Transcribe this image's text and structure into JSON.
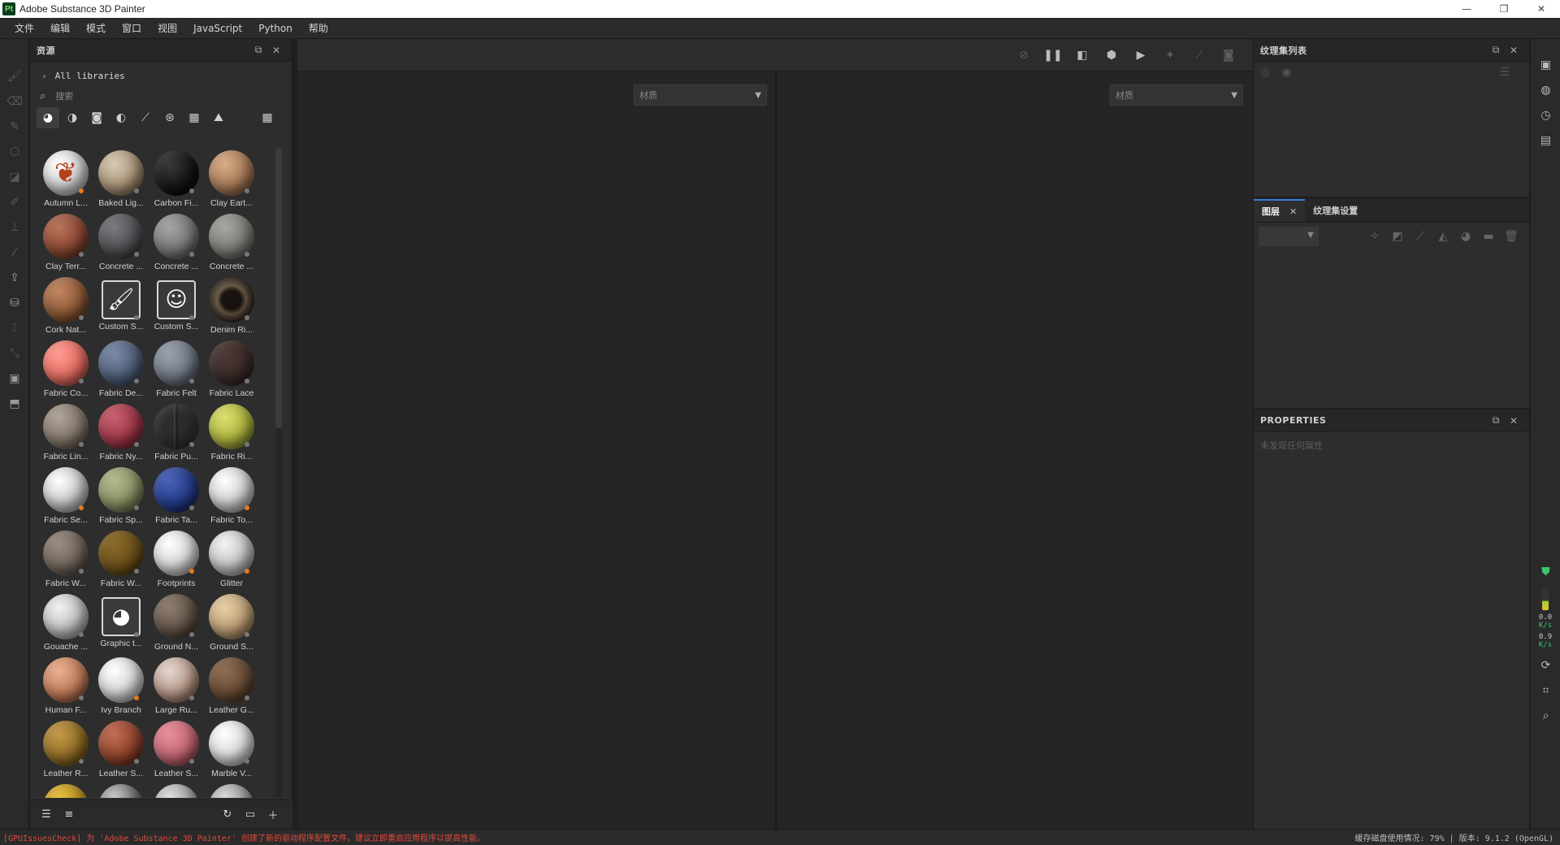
{
  "window": {
    "app_icon": "Pt",
    "title": "Adobe Substance 3D Painter",
    "minimize": "—",
    "restore": "❐",
    "close": "✕"
  },
  "menu": [
    "文件",
    "编辑",
    "模式",
    "窗口",
    "视图",
    "JavaScript",
    "Python",
    "帮助"
  ],
  "assets": {
    "title": "资源",
    "libraries": "All libraries",
    "search_placeholder": "搜索",
    "items": [
      {
        "name": "Autumn L...",
        "color": "radial-gradient(circle at 35% 30%, #ffffff, #d8d8d8 40%, #8a8a8a)",
        "badge": "orange",
        "leaf": true
      },
      {
        "name": "Baked Lig...",
        "color": "radial-gradient(circle at 35% 30%, #d9cbb4, #a48f74 55%, #5a4a38)",
        "badge": "grey"
      },
      {
        "name": "Carbon Fi...",
        "color": "radial-gradient(circle at 35% 30%, #3a3a3a, #111 60%, #000)",
        "badge": "grey"
      },
      {
        "name": "Clay Eart...",
        "color": "radial-gradient(circle at 35% 30%, #d7ad88, #a67756 55%, #5e3d28)",
        "badge": "grey"
      },
      {
        "name": "Clay Terr...",
        "color": "radial-gradient(circle at 35% 30%, #b8735a, #8a4632 55%, #4a2418)",
        "badge": "grey"
      },
      {
        "name": "Concrete ...",
        "color": "radial-gradient(circle at 35% 30%, #7a7a7e, #4e4e52 55%, #2a2a2c)",
        "badge": "grey"
      },
      {
        "name": "Concrete ...",
        "color": "radial-gradient(circle at 35% 30%, #a4a4a4, #777 55%, #444)",
        "badge": "grey"
      },
      {
        "name": "Concrete ...",
        "color": "radial-gradient(circle at 35% 30%, #a8a6a0, #7c7a74 55%, #48463f)",
        "badge": "grey"
      },
      {
        "name": "Cork Nat...",
        "color": "radial-gradient(circle at 35% 30%, #c08560, #8e5a36 55%, #4f2e18)",
        "badge": "grey"
      },
      {
        "name": "Custom S...",
        "color": "#3a3a3a",
        "badge": "grey",
        "icon": "🖌"
      },
      {
        "name": "Custom S...",
        "color": "#3a3a3a",
        "badge": "grey",
        "icon": "☺"
      },
      {
        "name": "Denim Ri...",
        "color": "radial-gradient(circle at 50% 50%, #1a1410 30%, #6b5a48 45%, #2a211a 70%)",
        "badge": "grey"
      },
      {
        "name": "Fabric Co...",
        "color": "radial-gradient(circle at 35% 30%, #ff9c92, #e06b60 55%, #8a3530)",
        "badge": "grey"
      },
      {
        "name": "Fabric De...",
        "color": "radial-gradient(circle at 35% 30%, #7a8aa6, #4e5e78 55%, #283448)",
        "badge": "grey"
      },
      {
        "name": "Fabric Felt",
        "color": "radial-gradient(circle at 35% 30%, #9aa2ae, #6e7682 55%, #3e444e)",
        "badge": "grey"
      },
      {
        "name": "Fabric Lace",
        "color": "radial-gradient(circle at 35% 30%, #4e3a38, #3a2a28 55%, #241816)",
        "badge": "grey"
      },
      {
        "name": "Fabric Lin...",
        "color": "radial-gradient(circle at 35% 30%, #b0a49a, #807468 55%, #4a423a)",
        "badge": "grey"
      },
      {
        "name": "Fabric Ny...",
        "color": "radial-gradient(circle at 35% 30%, #c8606e, #9a3444 55%, #561a24)",
        "badge": "grey"
      },
      {
        "name": "Fabric Pu...",
        "color": "linear-gradient(90deg, #2d2d2d 44%, #444 46%, #1d1d1d 50%, #2d2d2d 56%)",
        "badge": "grey"
      },
      {
        "name": "Fabric Ri...",
        "color": "radial-gradient(circle at 35% 30%, #dce070, #a8ae3a 55%, #5a5e18)",
        "badge": "grey"
      },
      {
        "name": "Fabric Se...",
        "color": "radial-gradient(circle at 35% 30%, #ffffff, #cfcfcf 45%, #7e7e7e)",
        "badge": "orange"
      },
      {
        "name": "Fabric Sp...",
        "color": "radial-gradient(circle at 35% 30%, #b4bc8e, #848c62 55%, #4a5034)",
        "badge": "grey"
      },
      {
        "name": "Fabric Ta...",
        "color": "radial-gradient(circle at 35% 30%, #4a62b8, #233a88 55%, #0e1a4a)",
        "badge": "grey"
      },
      {
        "name": "Fabric To...",
        "color": "radial-gradient(circle at 35% 30%, #ffffff, #d4d4d4 45%, #828282)",
        "badge": "orange"
      },
      {
        "name": "Fabric W...",
        "color": "radial-gradient(circle at 35% 30%, #9a8e84, #6e6258 55%, #3c342e)",
        "badge": "grey"
      },
      {
        "name": "Fabric W...",
        "color": "radial-gradient(circle at 35% 30%, #8a6a2a, #6a4e18 55%, #38280a)",
        "badge": "grey"
      },
      {
        "name": "Footprints",
        "color": "radial-gradient(circle at 35% 30%, #ffffff, #d8d8d8 45%, #8a8a8a)",
        "badge": "orange"
      },
      {
        "name": "Glitter",
        "color": "radial-gradient(circle at 35% 30%, #f4f4f4, #c8c8c8 45%, #7a7a7a)",
        "badge": "orange"
      },
      {
        "name": "Gouache ...",
        "color": "radial-gradient(circle at 35% 30%, #f2f2f2, #c4c4c4 45%, #777)",
        "badge": "grey"
      },
      {
        "name": "Graphic t...",
        "color": "#3a3a3a",
        "badge": "grey",
        "icon": "◕"
      },
      {
        "name": "Ground N...",
        "color": "radial-gradient(circle at 35% 30%, #8e7e70, #5e5044 55%, #30281f)",
        "badge": "grey"
      },
      {
        "name": "Ground S...",
        "color": "radial-gradient(circle at 35% 30%, #e8cfa6, #b89a72 55%, #6a5438)",
        "badge": "grey"
      },
      {
        "name": "Human F...",
        "color": "radial-gradient(circle at 35% 30%, #e8b090, #c07a58 55%, #6a3a24)",
        "badge": "grey"
      },
      {
        "name": "Ivy Branch",
        "color": "radial-gradient(circle at 35% 30%, #ffffff, #d8d8d8 45%, #8a8a8a)",
        "badge": "orange"
      },
      {
        "name": "Large Ru...",
        "color": "radial-gradient(circle at 35% 30%, #e4d8d0, #b49484 55%, #6a4a3c)",
        "badge": "grey"
      },
      {
        "name": "Leather G...",
        "color": "radial-gradient(circle at 35% 30%, #8e6c52, #654a34 55%, #34241a)",
        "badge": "grey"
      },
      {
        "name": "Leather R...",
        "color": "radial-gradient(circle at 35% 30%, #c49a4a, #8e6a24 55%, #4e380e)",
        "badge": "grey"
      },
      {
        "name": "Leather S...",
        "color": "radial-gradient(circle at 35% 30%, #c06e52, #8e402a 55%, #4a1e12)",
        "badge": "grey"
      },
      {
        "name": "Leather S...",
        "color": "radial-gradient(circle at 35% 30%, #e8909a, #c06470 55%, #6e2e38)",
        "badge": "grey"
      },
      {
        "name": "Marble V...",
        "color": "radial-gradient(circle at 35% 30%, #ffffff, #dcdcdc 45%, #8e8e8e)",
        "badge": "grey"
      },
      {
        "name": "",
        "color": "radial-gradient(circle at 35% 30%, #e8c040, #b08a1a 55%, #5a4408)",
        "badge": "grey"
      },
      {
        "name": "",
        "color": "radial-gradient(circle at 35% 30%, #cccccc, #666 55%, #222)",
        "badge": "grey"
      },
      {
        "name": "",
        "color": "radial-gradient(circle at 35% 30%, #e0e0e0, #9a9a9a 55%, #444)",
        "badge": "grey"
      },
      {
        "name": "",
        "color": "radial-gradient(circle at 35% 30%, #dcdcdc, #8e8e8e 55%, #3e3e3e)",
        "badge": "grey"
      }
    ]
  },
  "viewport": {
    "left_select": "材质",
    "right_select": "材质"
  },
  "texture_set_list": {
    "title": "纹理集列表"
  },
  "layers": {
    "tab_layers": "图层",
    "tab_settings": "纹理集设置"
  },
  "properties": {
    "title": "PROPERTIES",
    "empty": "未发现任何属性"
  },
  "sidestrip": {
    "net_down_value": "0.0",
    "net_down_unit": "K/s",
    "net_up_value": "0.9",
    "net_up_unit": "K/s"
  },
  "status": {
    "warning": "[GPUIssuesCheck] 为 'Adobe Substance 3D Painter' 创建了新的驱动程序配置文件。建议立即重启应用程序以提高性能。",
    "info": "缓存磁盘使用情况:  79% | 版本: 9.1.2 (OpenGL)"
  },
  "colors": {
    "accent": "#3a7bd5",
    "warning": "#e04a3a",
    "shield": "#3ec46d",
    "badge_orange": "#e57a1c"
  }
}
